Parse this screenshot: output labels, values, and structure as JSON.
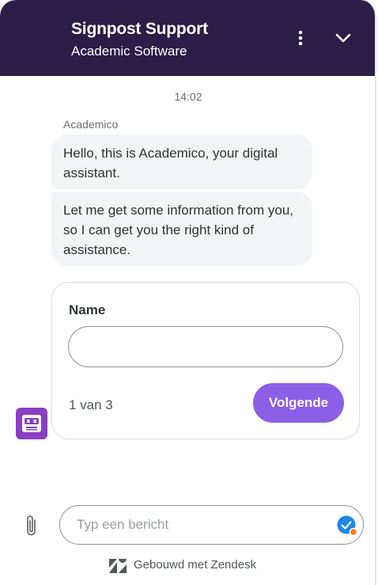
{
  "header": {
    "title": "Signpost Support",
    "subtitle": "Academic Software"
  },
  "conversation": {
    "timestamp": "14:02",
    "sender_name": "Academico",
    "messages": [
      {
        "text": "Hello, this is Academico, your digital assistant."
      },
      {
        "text": "Let me get some information from you, so I can get you the right kind of assistance."
      }
    ]
  },
  "form": {
    "field_label": "Name",
    "field_value": "",
    "step_text": "1 van 3",
    "next_label": "Volgende"
  },
  "composer": {
    "placeholder": "Typ een bericht"
  },
  "branding": {
    "text": "Gebouwd met Zendesk"
  },
  "colors": {
    "header_bg": "#2b1d47",
    "accent": "#8d5ee6",
    "avatar": "#8a3ec2",
    "bubble_bg": "#f3f4f6"
  },
  "icons": {
    "menu": "vertical-dots-icon",
    "collapse": "chevron-down-icon",
    "avatar": "robot-icon",
    "attach": "paperclip-icon",
    "extension": "checkmark-badge-icon",
    "brand": "zendesk-logo-icon"
  }
}
